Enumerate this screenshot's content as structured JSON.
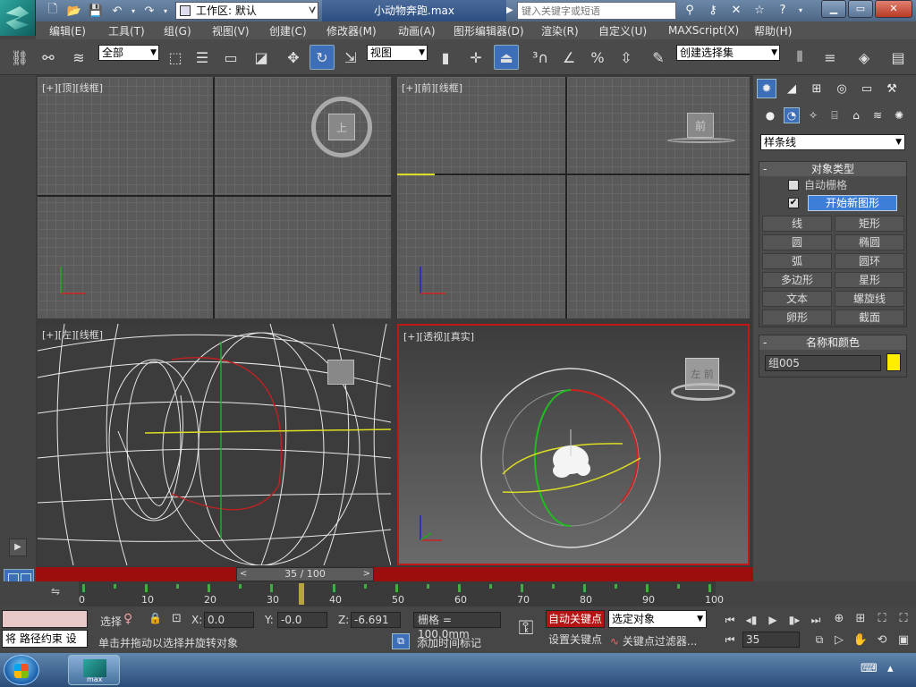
{
  "titlebar": {
    "workspace_label": "工作区: 默认",
    "file_title": "小动物奔跑.max",
    "search_placeholder": "键入关键字或短语",
    "icons": [
      "new-file-icon",
      "open-folder-icon",
      "save-icon",
      "undo-icon",
      "redo-icon",
      "project-folder-icon"
    ]
  },
  "menubar": {
    "items": [
      "编辑(E)",
      "工具(T)",
      "组(G)",
      "视图(V)",
      "创建(C)",
      "修改器(M)",
      "动画(A)",
      "图形编辑器(D)",
      "渲染(R)",
      "自定义(U)",
      "MAXScript(X)",
      "帮助(H)"
    ]
  },
  "toolbar": {
    "selection_filter": "全部",
    "reference_coord": "视图",
    "named_selection": "创建选择集"
  },
  "viewports": {
    "top": {
      "label_plus": "[+]",
      "label_view": "[顶]",
      "label_shade": "[线框]",
      "cube_text": "上"
    },
    "front": {
      "label_plus": "[+]",
      "label_view": "[前]",
      "label_shade": "[线框]",
      "cube_text": "前"
    },
    "left": {
      "label_plus": "[+]",
      "label_view": "[左]",
      "label_shade": "[线框]"
    },
    "perspective": {
      "label_plus": "[+]",
      "label_view": "[透视]",
      "label_shade": "[真实]",
      "cube_text": "左 前"
    }
  },
  "command_panel": {
    "category": "样条线",
    "object_type": {
      "header": "对象类型",
      "auto_grid": "自动栅格",
      "start_new_shape": "开始新图形",
      "buttons": [
        "线",
        "矩形",
        "圆",
        "椭圆",
        "弧",
        "圆环",
        "多边形",
        "星形",
        "文本",
        "螺旋线",
        "卵形",
        "截面"
      ]
    },
    "name_color": {
      "header": "名称和颜色",
      "name": "组005",
      "color": "#ffee00"
    }
  },
  "timeline": {
    "slider": "35 / 100",
    "prev_arrow": "<",
    "next_arrow": ">",
    "ticks": [
      "0",
      "10",
      "20",
      "30",
      "40",
      "50",
      "60",
      "70",
      "80",
      "90",
      "100"
    ],
    "current_frame": 35
  },
  "status": {
    "maxscript_text": "将 路径约束 设",
    "select_label": "选择",
    "x_label": "X:",
    "x": "0.0",
    "y_label": "Y:",
    "y": "-0.0",
    "z_label": "Z:",
    "z": "-6.691",
    "grid": "栅格 = 100.0mm",
    "prompt": "单击并拖动以选择并旋转对象",
    "add_time_tag": "添加时间标记",
    "auto_key": "自动关键点",
    "set_key": "设置关键点",
    "selected_set": "选定对象",
    "key_filters": "关键点过滤器...",
    "frame": "35"
  },
  "taskbar": {
    "max_label": "max"
  }
}
